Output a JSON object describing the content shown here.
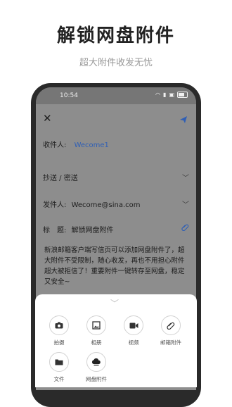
{
  "promo": {
    "headline": "解锁网盘附件",
    "subline": "超大附件收发无忧"
  },
  "status_bar": {
    "time": "10:54"
  },
  "compose": {
    "to_label": "收件人:",
    "to_value": "Wecome1",
    "cc_label": "抄送 / 密送",
    "from_label": "发件人:",
    "from_value": "Wecome@sina.com",
    "subject_label": "标　题:",
    "subject_value": "解锁网盘附件",
    "body": "新浪邮箱客户端写信页可以添加网盘附件了，超大附件不受限制，随心收发，再也不用担心附件超大被拒信了！重要附件一键转存至网盘，稳定又安全~"
  },
  "attachments": [
    {
      "label": "拍摄",
      "icon": "camera-icon"
    },
    {
      "label": "相册",
      "icon": "photo-album-icon"
    },
    {
      "label": "视频",
      "icon": "video-icon"
    },
    {
      "label": "邮箱附件",
      "icon": "paperclip-icon"
    },
    {
      "label": "文件",
      "icon": "folder-icon"
    },
    {
      "label": "网盘附件",
      "icon": "cloud-drive-icon"
    }
  ],
  "colors": {
    "accent_blue": "#2f5fb5",
    "overlay_gray": "#8d8d8d"
  }
}
